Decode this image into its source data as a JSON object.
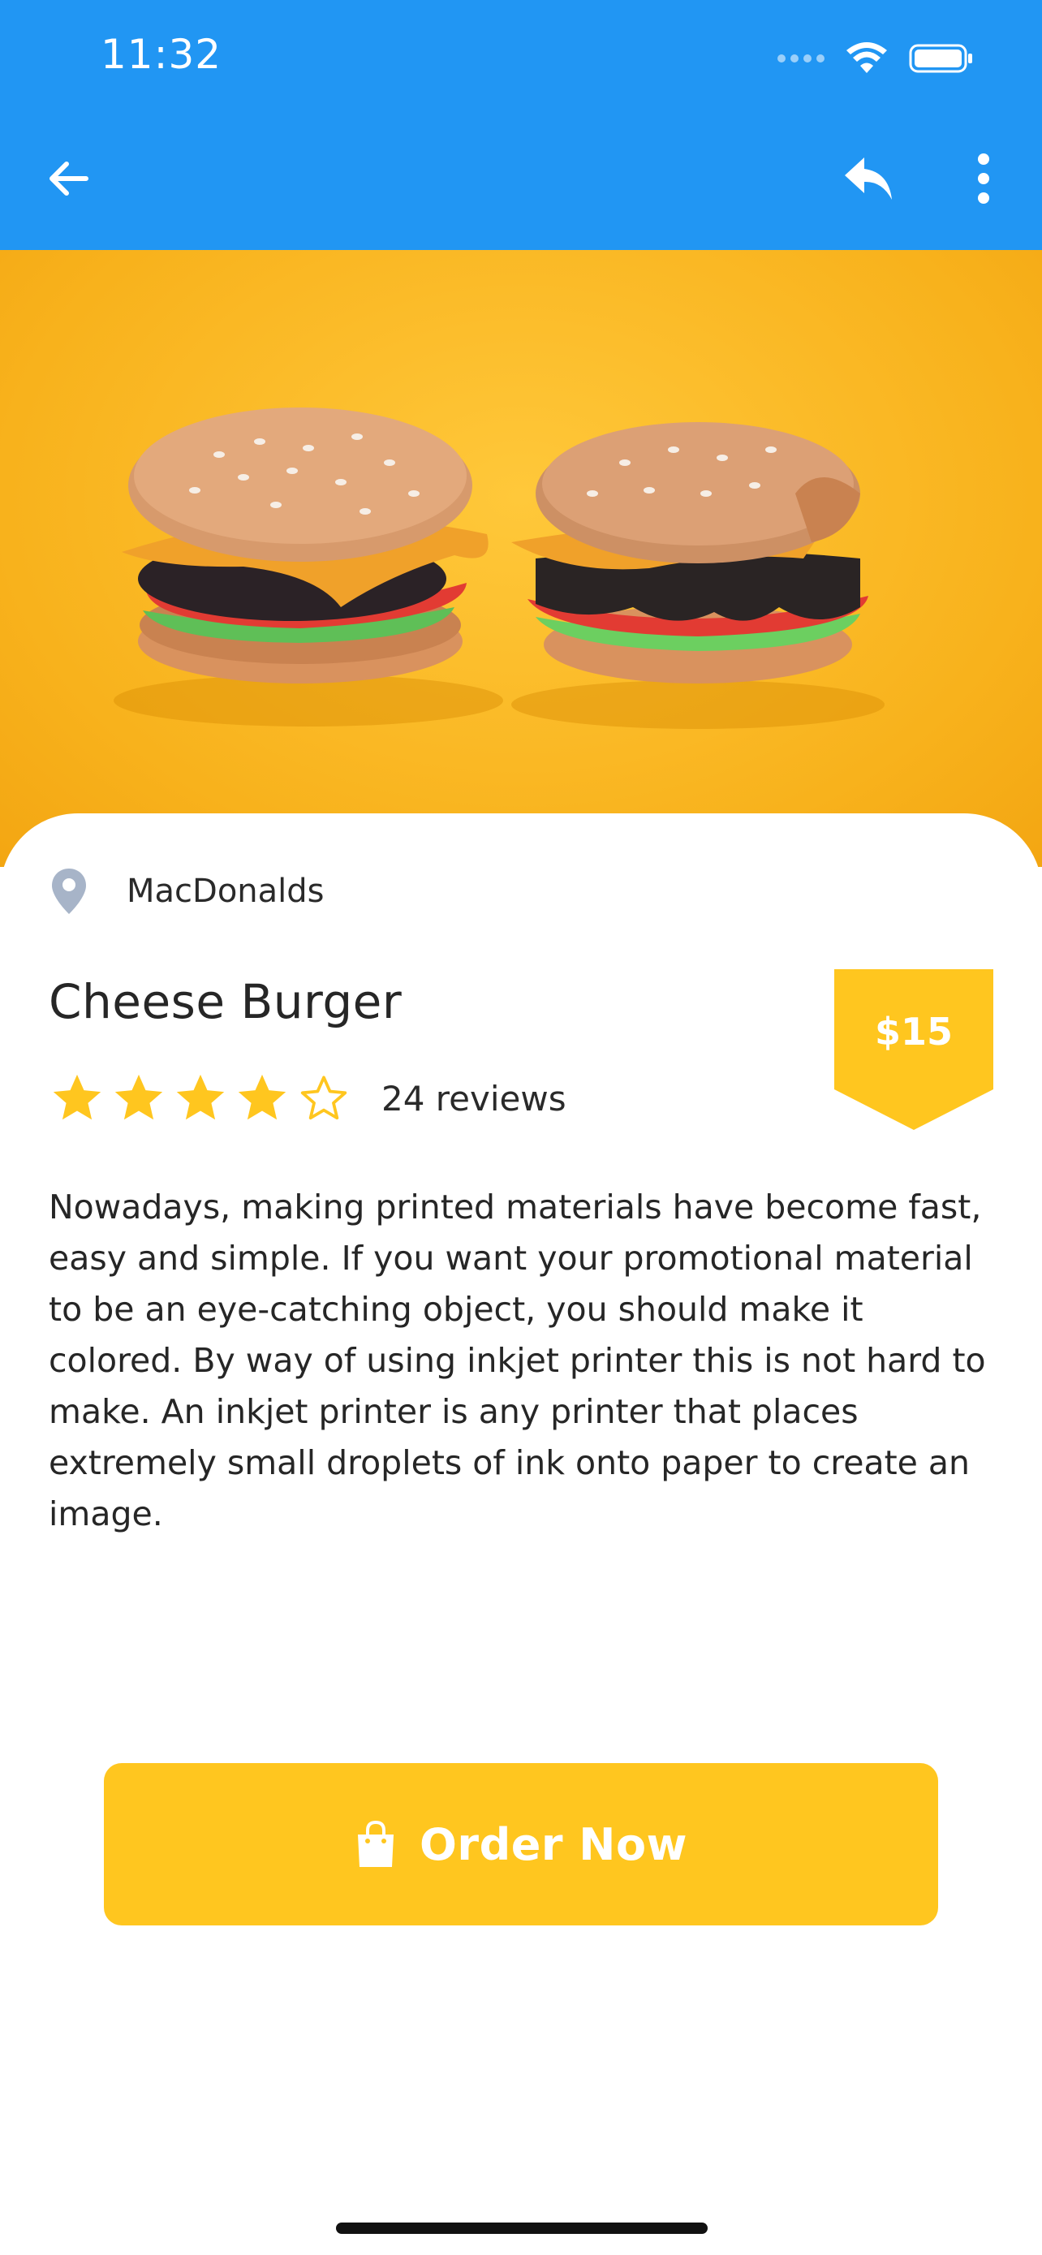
{
  "status_bar": {
    "time": "11:32"
  },
  "app_bar": {
    "background": "#2196F3",
    "icons": [
      "arrow-back-icon",
      "reply-icon",
      "more-vert-icon"
    ]
  },
  "hero": {
    "image": "macaron-cheeseburgers-on-yellow-background"
  },
  "product": {
    "restaurant": "MacDonalds",
    "name": "Cheese Burger",
    "price": "$15",
    "rating": 4,
    "rating_max": 5,
    "reviews": "24 reviews",
    "description": "Nowadays, making printed materials have become fast, easy and simple. If you want your promotional material to be an eye-catching object, you should make it colored. By way of using inkjet printer this is not hard to make. An inkjet printer is any printer that places extremely small droplets of ink onto paper to create an image."
  },
  "actions": {
    "order_label": "Order Now",
    "order_icon": "shopping-bag-icon"
  },
  "colors": {
    "accent": "#FFC61F",
    "primary": "#2196F3",
    "location_pin": "#A7B4C8"
  }
}
